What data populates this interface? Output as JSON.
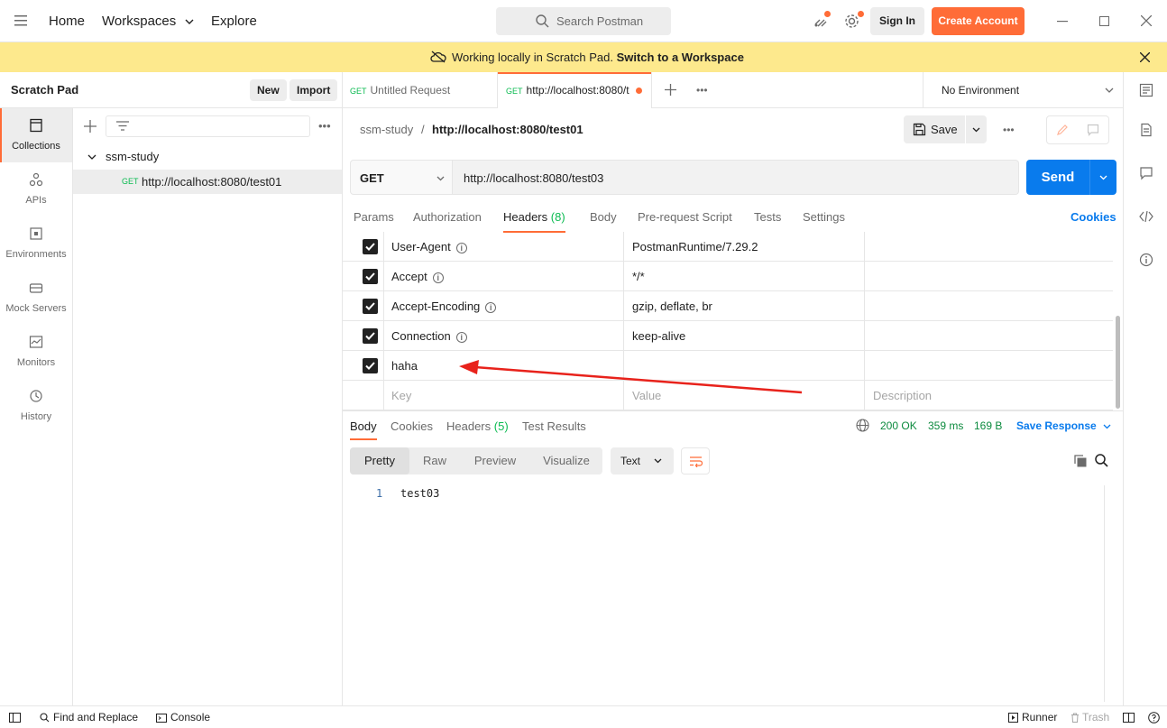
{
  "topbar": {
    "nav": [
      "Home",
      "Workspaces",
      "Explore"
    ],
    "search_placeholder": "Search Postman",
    "sign_in": "Sign In",
    "create_account": "Create Account"
  },
  "banner": {
    "text": "Working locally in Scratch Pad.",
    "link": "Switch to a Workspace"
  },
  "leftrail": {
    "items": [
      {
        "label": "Collections",
        "icon": "collections-icon"
      },
      {
        "label": "APIs",
        "icon": "apis-icon"
      },
      {
        "label": "Environments",
        "icon": "environments-icon"
      },
      {
        "label": "Mock Servers",
        "icon": "mock-servers-icon"
      },
      {
        "label": "Monitors",
        "icon": "monitors-icon"
      },
      {
        "label": "History",
        "icon": "history-icon"
      }
    ]
  },
  "sidebar": {
    "title": "Scratch Pad",
    "new_label": "New",
    "import_label": "Import",
    "collection_name": "ssm-study",
    "request_method": "GET",
    "request_name": "http://localhost:8080/test01"
  },
  "tabs": [
    {
      "method": "GET",
      "label": "Untitled Request"
    },
    {
      "method": "GET",
      "label": "http://localhost:8080/t"
    }
  ],
  "environment": "No Environment",
  "request": {
    "breadcrumb_collection": "ssm-study",
    "breadcrumb_sep": "/",
    "breadcrumb_name": "http://localhost:8080/test01",
    "save_label": "Save",
    "method": "GET",
    "url": "http://localhost:8080/test03",
    "send_label": "Send",
    "tabs": [
      {
        "label": "Params"
      },
      {
        "label": "Authorization"
      },
      {
        "label": "Headers",
        "count": "(8)"
      },
      {
        "label": "Body"
      },
      {
        "label": "Pre-request Script"
      },
      {
        "label": "Tests"
      },
      {
        "label": "Settings"
      }
    ],
    "cookies_link": "Cookies"
  },
  "headers": {
    "rows": [
      {
        "key": "User-Agent",
        "value": "PostmanRuntime/7.29.2",
        "info": true
      },
      {
        "key": "Accept",
        "value": "*/*",
        "info": true
      },
      {
        "key": "Accept-Encoding",
        "value": "gzip, deflate, br",
        "info": true
      },
      {
        "key": "Connection",
        "value": "keep-alive",
        "info": true
      },
      {
        "key": "haha",
        "value": "",
        "info": false
      }
    ],
    "placeholder": {
      "key": "Key",
      "value": "Value",
      "description": "Description"
    }
  },
  "response": {
    "tabs": [
      {
        "label": "Body"
      },
      {
        "label": "Cookies"
      },
      {
        "label": "Headers",
        "count": "(5)"
      },
      {
        "label": "Test Results"
      }
    ],
    "status": "200 OK",
    "time": "359 ms",
    "size": "169 B",
    "save_response": "Save Response",
    "views": [
      "Pretty",
      "Raw",
      "Preview",
      "Visualize"
    ],
    "format": "Text",
    "line_number": "1",
    "body_text": "test03"
  },
  "statusbar": {
    "find_replace": "Find and Replace",
    "console": "Console",
    "runner": "Runner",
    "trash": "Trash"
  },
  "colors": {
    "accent_orange": "#ff6c37",
    "send_blue": "#097bed",
    "banner_yellow": "#fde98d",
    "success_green": "#0cbb52",
    "annotation_red": "#e8221b"
  }
}
